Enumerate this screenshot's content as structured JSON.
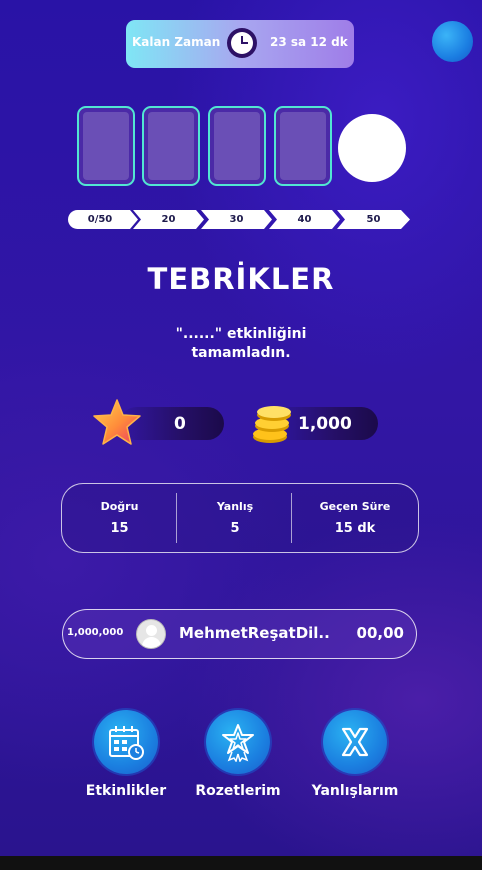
{
  "timer": {
    "label": "Kalan Zaman",
    "value": "23 sa 12 dk"
  },
  "progress_steps": [
    "0/50",
    "20",
    "30",
    "40",
    "50"
  ],
  "title": "TEBRİKLER",
  "subtitle_line1": "\"......\" etkinliğini",
  "subtitle_line2": "tamamladın.",
  "rewards": {
    "stars": "0",
    "coins": "1,000"
  },
  "stats": [
    {
      "label": "Doğru",
      "value": "15"
    },
    {
      "label": "Yanlış",
      "value": "5"
    },
    {
      "label": "Geçen Süre",
      "value": "15 dk"
    }
  ],
  "leaderboard": {
    "points": "1,000,000",
    "name": "MehmetReşatDil..",
    "score": "00,00"
  },
  "nav": [
    {
      "label": "Etkinlikler",
      "icon": "calendar-icon"
    },
    {
      "label": "Rozetlerim",
      "icon": "badge-icon"
    },
    {
      "label": "Yanlışlarım",
      "icon": "x-icon"
    }
  ],
  "colors": {
    "accent_teal": "#52e6d2",
    "nav_blue": "#1b7fe0",
    "background": "#2a168f"
  }
}
